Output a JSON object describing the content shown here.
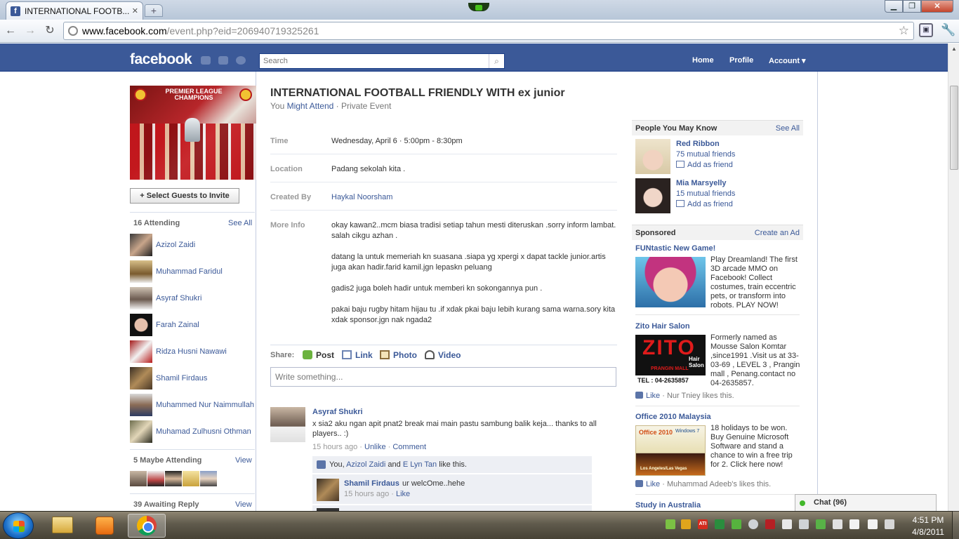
{
  "browser": {
    "tab_title": "INTERNATIONAL FOOTB...",
    "tab_close": "✕",
    "new_tab": "+",
    "url_domain": "www.facebook.com",
    "url_path": "/event.php?eid=206940719325261"
  },
  "header": {
    "logo": "facebook",
    "search_placeholder": "Search",
    "nav": {
      "home": "Home",
      "profile": "Profile",
      "account": "Account ▾"
    }
  },
  "left": {
    "photo_banner": "PREMIER LEAGUE CHAMPIONS",
    "invite_button": "+ Select Guests to Invite",
    "attending": {
      "title": "16 Attending",
      "see_all": "See All",
      "people": [
        "Azizol Zaidi",
        "Muhammad Faridul",
        "Asyraf Shukri",
        "Farah Zainal",
        "Ridza Husni Nawawi",
        "Shamil Firdaus",
        "Muhammed Nur Naimmullah",
        "Muhamad Zulhusni Othman"
      ]
    },
    "maybe": {
      "title": "5 Maybe Attending",
      "view": "View"
    },
    "awaiting": {
      "title": "39 Awaiting Reply",
      "view": "View"
    }
  },
  "event": {
    "title": "INTERNATIONAL FOOTBALL FRIENDLY WITH ex junior",
    "sub_you": "You",
    "sub_rsvp": "Might Attend",
    "sub_type": "· Private Event",
    "time_label": "Time",
    "time": "Wednesday, April 6 · 5:00pm - 8:30pm",
    "location_label": "Location",
    "location": "Padang sekolah kita .",
    "created_label": "Created By",
    "created_by": "Haykal Noorsham",
    "more_label": "More Info",
    "more_info": [
      "okay kawan2..mcm biasa tradisi setiap tahun mesti diteruskan .sorry inform lambat. salah cikgu azhan .",
      "datang la untuk memeriah kn suasana .siapa yg xpergi x dapat tackle junior.artis juga akan hadir.farid kamil.jgn lepaskn peluang",
      "gadis2 juga boleh hadir untuk memberi kn sokongannya pun .",
      "pakai baju rugby hitam hijau tu .if xdak pkai baju lebih kurang sama warna.sory kita xdak sponsor.jgn nak ngada2"
    ]
  },
  "share": {
    "label": "Share:",
    "post": "Post",
    "link": "Link",
    "photo": "Photo",
    "video": "Video",
    "placeholder": "Write something..."
  },
  "post": {
    "author": "Asyraf Shukri",
    "text": "x sia2 aku ngan apit pnat2 break mai main pastu sambung balik keja... thanks to all players.. :)",
    "time": "15 hours ago",
    "unlike": "Unlike",
    "comment": "Comment",
    "likes_you": "You,",
    "likes_p1": "Azizol Zaidi",
    "likes_and": "and",
    "likes_p2": "E Lyn Tan",
    "likes_suffix": "like this.",
    "reply": {
      "author": "Shamil Firdaus",
      "text": "ur welcOme..hehe",
      "time": "15 hours ago",
      "like": "Like"
    }
  },
  "right": {
    "pymk": {
      "title": "People You May Know",
      "see_all": "See All",
      "people": [
        {
          "name": "Red Ribbon",
          "mutual": "75 mutual friends",
          "add": "Add as friend"
        },
        {
          "name": "Mia Marsyelly",
          "mutual": "15 mutual friends",
          "add": "Add as friend"
        }
      ]
    },
    "sponsored": {
      "title": "Sponsored",
      "create": "Create an Ad",
      "ads": [
        {
          "title": "FUNtastic New Game!",
          "text": "Play Dreamland! The first 3D arcade MMO on Facebook! Collect costumes, train eccentric pets, or transform into robots. PLAY NOW!"
        },
        {
          "title": "Zito Hair Salon",
          "text": "Formerly named as Mousse Salon Komtar ,since1991 .Visit us at 33-03-69 , LEVEL 3 , Prangin mall , Penang.contact no 04-2635857.",
          "like": "Like",
          "liker": "· Nur Tniey likes this.",
          "img_logo": "ZITO",
          "img_sub": "Hair Salon",
          "img_mall": "PRANGIN MALL",
          "img_tel": "TEL : 04-2635857"
        },
        {
          "title": "Office 2010 Malaysia",
          "text": "18 holidays to be won. Buy Genuine Microsoft Software and stand a chance to win a free trip for 2. Click here now!",
          "like": "Like",
          "liker": "· Muhammad Adeeb's likes this.",
          "img_t1": "Office 2010",
          "img_t2": "Windows 7",
          "img_t3": "Los Angeles/Las Vegas"
        },
        {
          "title": "Study in Australia"
        }
      ]
    }
  },
  "chat": {
    "label": "Chat (96)"
  },
  "taskbar": {
    "time": "4:51 PM",
    "date": "4/8/2011"
  },
  "colors": {
    "facebook_blue": "#3b5998",
    "link": "#3b5998"
  }
}
